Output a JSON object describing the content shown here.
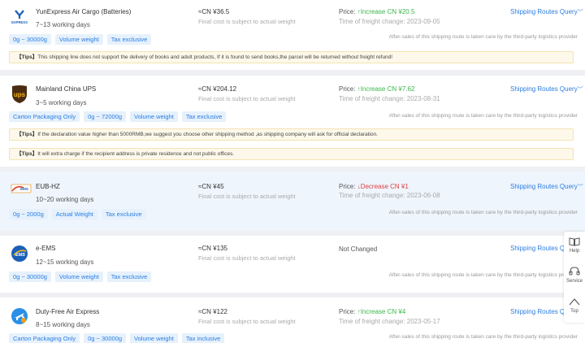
{
  "routes": [
    {
      "name": "YunExpress Air Cargo (Batteries)",
      "days": "7~13 working days",
      "cost": "≈CN ¥36.5",
      "cost_note": "Final cost is subject to actual weight",
      "price_label": "Price:",
      "price_change": "↑Increase  CN ¥20.5",
      "price_direction": "up",
      "price_time": "Time of freight change: 2023-09-05",
      "query": "Shipping Routes Query",
      "tags": [
        "0g ~ 30000g",
        "Volume weight",
        "Tax exclusive"
      ],
      "aftersales": "After-sales of this shipping route is taken care by the third-party logistics provider",
      "logo_text": "EXPRESS",
      "tips": [
        {
          "prefix": "【Tips】",
          "text": "This shipping line does not support the delivery of books and adult products, If it is found to send books,the parcel will be returned without freight refund!"
        }
      ]
    },
    {
      "name": "Mainland China UPS",
      "days": "3~5 working days",
      "cost": "≈CN ¥204.12",
      "cost_note": "Final cost is subject to actual weight",
      "price_label": "Price:",
      "price_change": "↑Increase  CN ¥7.62",
      "price_direction": "up",
      "price_time": "Time of freight change: 2023-08-31",
      "query": "Shipping Routes Query",
      "tags": [
        "Carton Packaging Only",
        "0g ~ 72000g",
        "Volume weight",
        "Tax exclusive"
      ],
      "aftersales": "After-sales of this shipping route is taken care by the third-party logistics provider",
      "logo_text": "ups",
      "tips": [
        {
          "prefix": "【Tips】",
          "text": "If the declaration value higher than 5000RMB,we suggest you choose other shipping method ,as shipping company will ask for official declaration."
        },
        {
          "prefix": "【Tips】",
          "text": "It will extra charge if the recipient address is private residence and not public offices."
        }
      ]
    },
    {
      "name": "EUB-HZ",
      "days": "10~20 working days",
      "cost": "≈CN ¥45",
      "cost_note": "Final cost is subject to actual weight",
      "price_label": "Price:",
      "price_change": "↓Decrease  CN ¥1",
      "price_direction": "down",
      "price_time": "Time of freight change: 2023-06-08",
      "query": "Shipping Routes Query",
      "tags": [
        "0g ~ 2000g",
        "Actual Weight",
        "Tax exclusive"
      ],
      "aftersales": "After-sales of this shipping route is taken care by the third-party logistics provider",
      "logo_text": "EMS",
      "tips": []
    },
    {
      "name": "e-EMS",
      "days": "12~15 working days",
      "cost": "≈CN ¥135",
      "cost_note": "Final cost is subject to actual weight",
      "price_label": "Not Changed",
      "price_change": "",
      "price_direction": "none",
      "price_time": "",
      "query": "Shipping Routes Query",
      "tags": [
        "0g ~ 30000g",
        "Volume weight",
        "Tax exclusive"
      ],
      "aftersales": "After-sales of this shipping route is taken care by the third-party logistics provider",
      "logo_text": "EMS",
      "tips": []
    },
    {
      "name": "Duty-Free Air Express",
      "days": "8~15 working days",
      "cost": "≈CN ¥122",
      "cost_note": "Final cost is subject to actual weight",
      "price_label": "Price:",
      "price_change": "↑Increase  CN ¥4",
      "price_direction": "up",
      "price_time": "Time of freight change: 2023-05-17",
      "query": "Shipping Routes Query",
      "tags": [
        "Carton Packaging Only",
        "0g ~ 30000g",
        "Volume weight",
        "Tax inclusive"
      ],
      "aftersales": "After-sales of this shipping route is taken care by the third-party logistics provider",
      "logo_text": "",
      "tips": []
    }
  ],
  "float_panel": {
    "help": "Help",
    "service": "Service",
    "top": "Top"
  },
  "colors": {
    "accent": "#2a7de1",
    "increase": "#3bb54a",
    "decrease": "#e04040",
    "tip_bg": "#fdf8ea",
    "tag_bg": "#e6f1fc"
  }
}
